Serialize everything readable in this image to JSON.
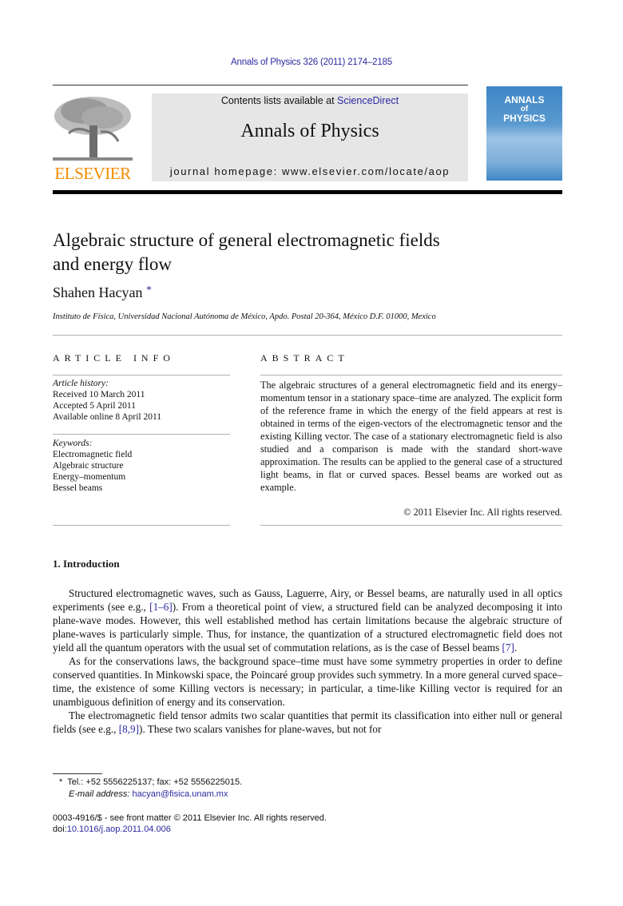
{
  "journal_ref": "Annals of Physics 326 (2011) 2174–2185",
  "header": {
    "contents_prefix": "Contents lists available at ",
    "contents_link": "ScienceDirect",
    "journal_title": "Annals of Physics",
    "homepage": "journal homepage: www.elsevier.com/locate/aop",
    "publisher_logo_text": "ELSEVIER",
    "cover": {
      "line1": "ANNALS",
      "line2": "of",
      "line3": "PHYSICS"
    }
  },
  "article": {
    "title_line1": "Algebraic structure of general electromagnetic fields",
    "title_line2": "and energy flow",
    "author": "Shahen Hacyan",
    "author_mark": "*",
    "affiliation": "Instituto de Física, Universidad Nacional Autónoma de México, Apdo. Postal 20-364, México D.F. 01000, Mexico"
  },
  "article_info": {
    "heading": "ARTICLE INFO",
    "history_label": "Article history:",
    "history": [
      "Received 10 March 2011",
      "Accepted 5 April 2011",
      "Available online 8 April 2011"
    ],
    "keywords_label": "Keywords:",
    "keywords": [
      "Electromagnetic field",
      "Algebraic structure",
      "Energy–momentum",
      "Bessel beams"
    ]
  },
  "abstract": {
    "heading": "ABSTRACT",
    "text": "The algebraic structures of a general electromagnetic field and its energy–momentum tensor in a stationary space–time are analyzed. The explicit form of the reference frame in which the energy of the field appears at rest is obtained in terms of the eigen-vectors of the electromagnetic tensor and the existing Killing vector. The case of a stationary electromagnetic field is also studied and a comparison is made with the standard short-wave approximation. The results can be applied to the general case of a structured light beams, in flat or curved spaces. Bessel beams are worked out as example.",
    "copyright": "© 2011 Elsevier Inc. All rights reserved."
  },
  "introduction": {
    "heading": "1. Introduction",
    "p1_a": "Structured electromagnetic waves, such as Gauss, Laguerre, Airy, or Bessel beams, are naturally used in all optics experiments (see e.g., ",
    "p1_ref1": "[1–6]",
    "p1_b": "). From a theoretical point of view, a structured field can be analyzed decomposing it into plane-wave modes. However, this well established method has certain limitations because the algebraic structure of plane-waves is particularly simple. Thus, for instance, the quantization of a structured electromagnetic field does not yield all the quantum operators with the usual set of commutation relations, as is the case of Bessel beams ",
    "p1_ref2": "[7]",
    "p1_c": ".",
    "p2": "As for the conservations laws, the background space–time must have some symmetry properties in order to define conserved quantities. In Minkowski space, the Poincaré group provides such symmetry. In a more general curved space–time, the existence of some Killing vectors is necessary; in particular, a time-like Killing vector is required for an unambiguous definition of energy and its conservation.",
    "p3_a": "The electromagnetic field tensor admits two scalar quantities that permit its classification into either null or general fields (see e.g., ",
    "p3_ref": "[8,9]",
    "p3_b": "). These two scalars vanishes for plane-waves, but not for"
  },
  "footnote": {
    "mark": "*",
    "tel": "Tel.: +52 5556225137; fax: +52 5556225015.",
    "email_label": "E-mail address:",
    "email": "hacyan@fisica.unam.mx",
    "issn": "0003-4916/$ - see front matter © 2011 Elsevier Inc. All rights reserved.",
    "doi_label": "doi:",
    "doi": "10.1016/j.aop.2011.04.006"
  }
}
